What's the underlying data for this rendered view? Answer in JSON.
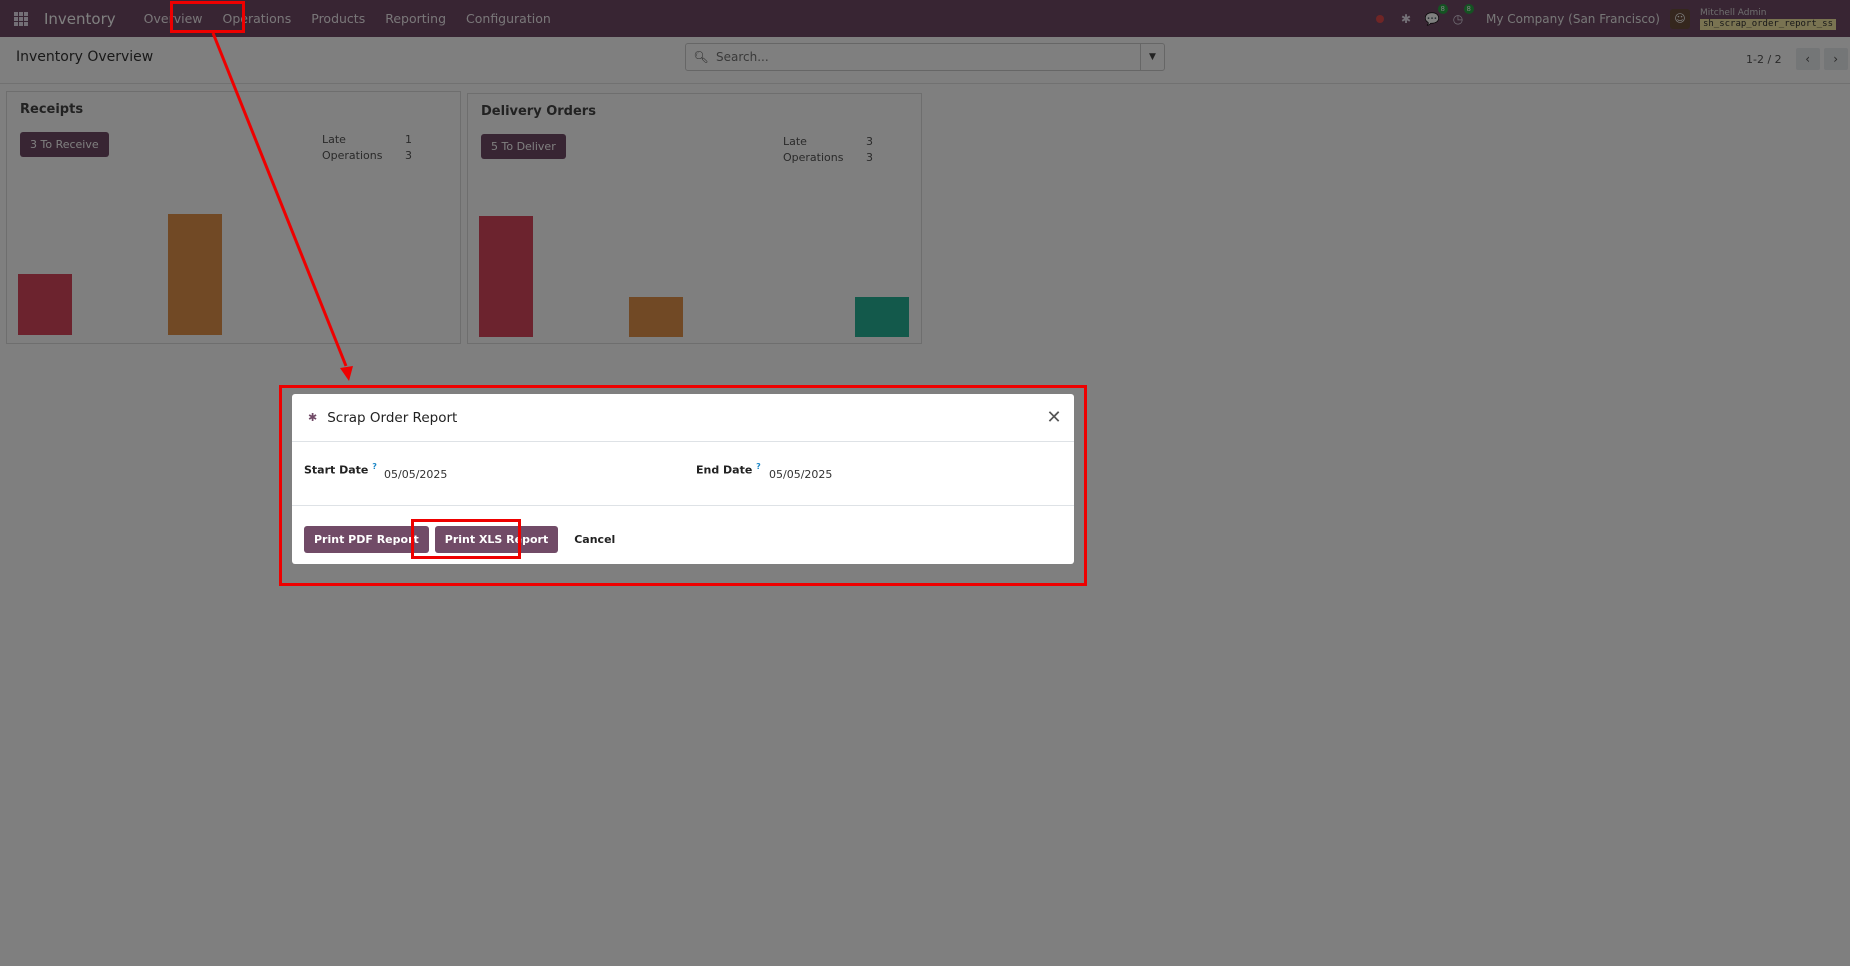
{
  "navbar": {
    "app_name": "Inventory",
    "menu": [
      "Overview",
      "Operations",
      "Products",
      "Reporting",
      "Configuration"
    ],
    "messages_badge": "8",
    "activities_badge": "8",
    "company": "My Company (San Francisco)",
    "user_name": "Mitchell Admin",
    "database": "sh_scrap_order_report_ss"
  },
  "control_panel": {
    "title": "Inventory Overview",
    "search_placeholder": "Search...",
    "pager": "1-2 / 2"
  },
  "cards": [
    {
      "title": "Receipts",
      "button": "3 To Receive",
      "stats": [
        {
          "label": "Late",
          "value": "1"
        },
        {
          "label": "Operations",
          "value": "3"
        }
      ]
    },
    {
      "title": "Delivery Orders",
      "button": "5 To Deliver",
      "stats": [
        {
          "label": "Late",
          "value": "3"
        },
        {
          "label": "Operations",
          "value": "3"
        }
      ]
    }
  ],
  "modal": {
    "title": "Scrap Order Report",
    "start_label": "Start Date",
    "start_value": "05/05/2025",
    "end_label": "End Date",
    "end_value": "05/05/2025",
    "help_mark": "?",
    "print_pdf": "Print PDF Report",
    "print_xls": "Print XLS Report",
    "cancel": "Cancel"
  },
  "colors": {
    "brand": "#714b67",
    "bar_red": "#d9475c",
    "bar_orange": "#e3934b",
    "bar_teal": "#27b396",
    "annotation": "#ee0000"
  }
}
